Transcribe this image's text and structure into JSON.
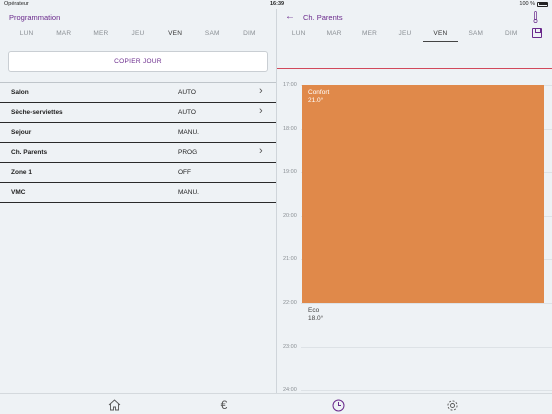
{
  "status_bar": {
    "carrier": "Opérateur",
    "time": "16:39",
    "battery": "100 %"
  },
  "left_panel": {
    "title": "Programmation",
    "days": [
      "LUN",
      "MAR",
      "MER",
      "JEU",
      "VEN",
      "SAM",
      "DIM"
    ],
    "active_day": "VEN",
    "copy_button": "COPIER JOUR",
    "rooms": [
      {
        "name": "Salon",
        "mode": "AUTO",
        "has_chevron": true
      },
      {
        "name": "Sèche-serviettes",
        "mode": "AUTO",
        "has_chevron": true
      },
      {
        "name": "Sejour",
        "mode": "MANU.",
        "has_chevron": false
      },
      {
        "name": "Ch. Parents",
        "mode": "PROG",
        "has_chevron": true
      },
      {
        "name": "Zone 1",
        "mode": "OFF",
        "has_chevron": false
      },
      {
        "name": "VMC",
        "mode": "MANU.",
        "has_chevron": false
      }
    ]
  },
  "right_panel": {
    "title": "Ch. Parents",
    "days": [
      "LUN",
      "MAR",
      "MER",
      "JEU",
      "VEN",
      "SAM",
      "DIM"
    ],
    "active_day": "VEN",
    "hours": [
      "17:00",
      "18:00",
      "19:00",
      "20:00",
      "21:00",
      "22:00",
      "23:00",
      "24:00"
    ],
    "comfort": {
      "label": "Confort",
      "temp": "21.0°",
      "start": "17:00",
      "end": "22:00",
      "color": "#e0894a"
    },
    "eco": {
      "label": "Eco",
      "temp": "18.0°"
    }
  },
  "tabbar": {
    "items": [
      "home-icon",
      "euro-icon",
      "clock-icon",
      "gear-icon"
    ],
    "active": "clock-icon"
  },
  "colors": {
    "accent": "#6a2a8c",
    "comfort": "#e0894a",
    "divider_red": "#d1495b"
  }
}
